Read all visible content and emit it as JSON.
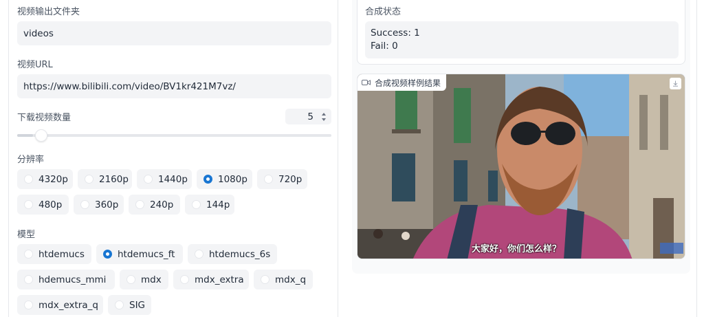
{
  "left": {
    "output_folder": {
      "label": "视频输出文件夹",
      "value": "videos"
    },
    "video_url": {
      "label": "视频URL",
      "value": "https://www.bilibili.com/video/BV1kr421M7vz/"
    },
    "download_count": {
      "label": "下载视频数量",
      "value": "5",
      "slider_fraction": 0.05
    },
    "resolution": {
      "label": "分辨率",
      "options": [
        "4320p",
        "2160p",
        "1440p",
        "1080p",
        "720p",
        "480p",
        "360p",
        "240p",
        "144p"
      ],
      "selected": "1080p"
    },
    "model": {
      "label": "模型",
      "options": [
        "htdemucs",
        "htdemucs_ft",
        "htdemucs_6s",
        "hdemucs_mmi",
        "mdx",
        "mdx_extra",
        "mdx_q",
        "mdx_extra_q",
        "SIG"
      ],
      "selected": "htdemucs_ft"
    }
  },
  "right": {
    "status": {
      "label": "合成状态",
      "line1": "Success: 1",
      "line2": "Fail: 0"
    },
    "video": {
      "label": "合成视频样例结果",
      "subtitle": "大家好，你们怎么样？",
      "icon": "video-camera-icon",
      "download_icon": "download-icon"
    }
  },
  "colors": {
    "accent": "#1976d2",
    "field_bg": "#f3f4f6"
  }
}
